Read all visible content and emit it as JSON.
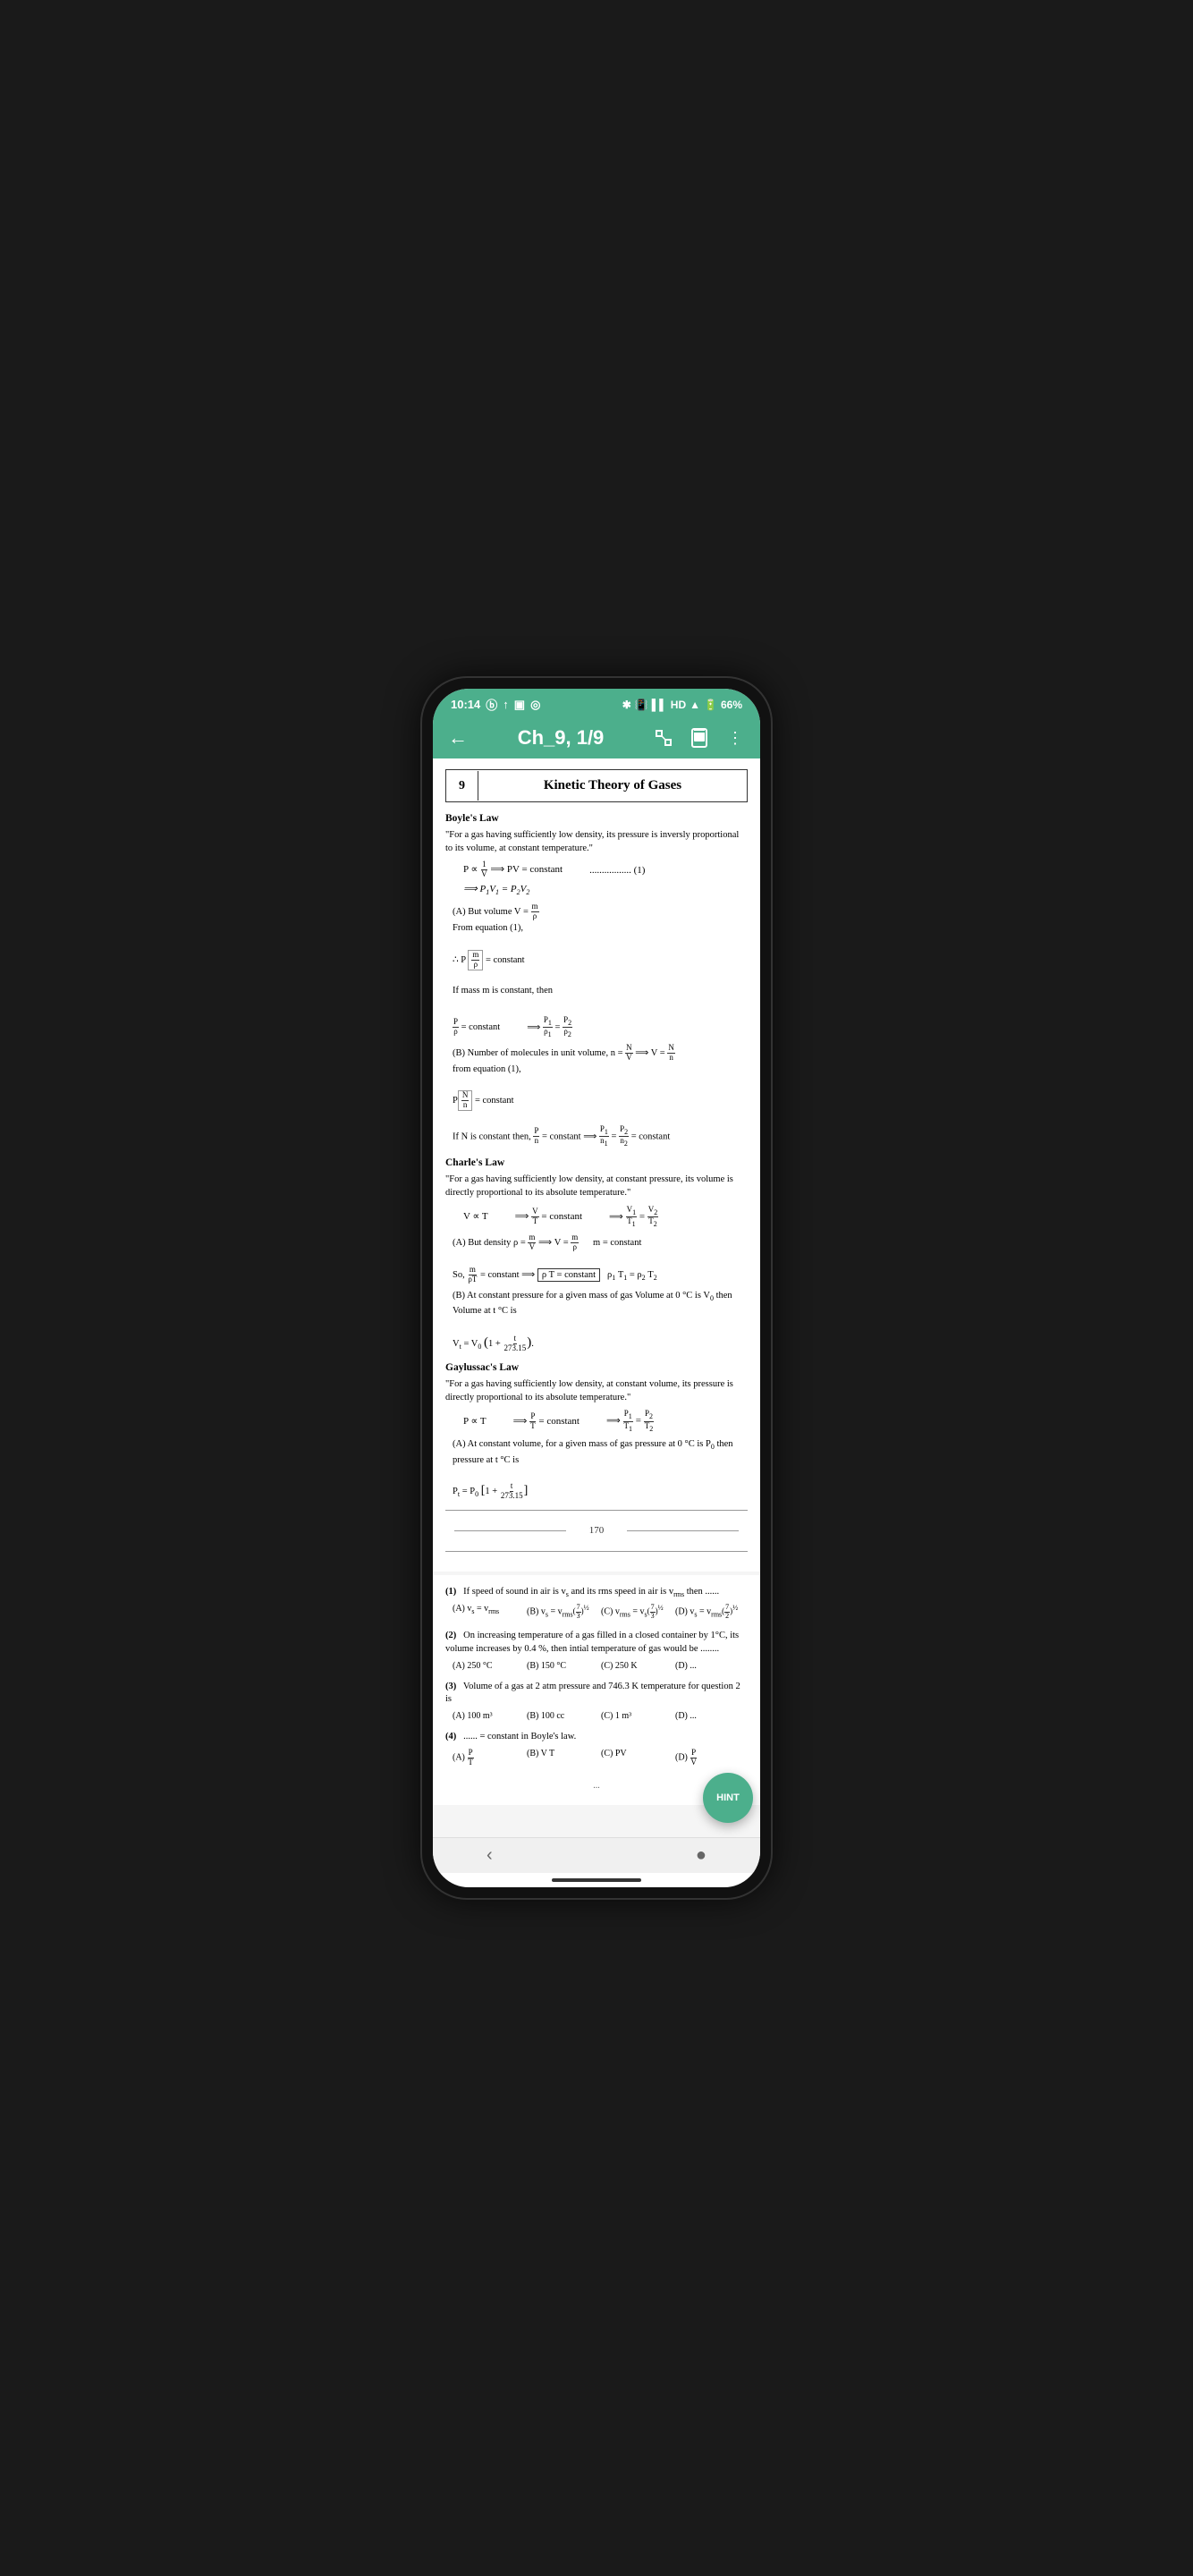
{
  "status_bar": {
    "time": "10:14",
    "icons": [
      "B",
      "↑",
      "☐",
      "@"
    ],
    "right_icons": [
      "bluetooth",
      "vibrate",
      "signal",
      "HD",
      "wifi",
      "battery"
    ],
    "battery": "66%"
  },
  "nav_bar": {
    "back_label": "←",
    "title": "Ch_9, 1/9",
    "icon_expand": "expand",
    "icon_bookmark": "bookmark",
    "icon_more": "more"
  },
  "chapter": {
    "number": "9",
    "title": "Kinetic Theory of Gases"
  },
  "sections": {
    "boyles_law": {
      "heading": "Boyle's Law",
      "quote": "\"For a gas having sufficiently low density, its pressure is inversly proportional to its volume, at constant temperature.\"",
      "equations": [
        "P ∝ 1/V  ⟹ PV = constant  ................. (1)",
        "⟹ P₁V₁ = P₂V₂",
        "(A) But volume V = m/ρ",
        "From equation (1),",
        "∴ P(m/ρ) = constant",
        "If mass m is constant, then",
        "P/ρ = constant  ⟹  P₁/ρ₁ = P₂/ρ₂",
        "(B) Number of molecules in unit volume, n = N/V ⟹ V = N/n",
        "from equation (1),",
        "P(N/n) = constant",
        "If N is constant then, P/n = constant ⟹ P₁/n₁ = P₂/n₂ = constant"
      ]
    },
    "charles_law": {
      "heading": "Charle's Law",
      "quote": "\"For a gas having sufficiently low density, at constant pressure, its volume is directly proportional to its absolute temperature.\"",
      "equations": [
        "V ∝ T  ⟹  V/T = constant  ⟹  V₁/T₁ = V₂/T₂",
        "(A) But density ρ = m/V ⟹ V = m/ρ  m = constant",
        "So, m/ρT = constant ⟹ ρT = constant  ρ₁T₁ = ρ₂T₂",
        "(B) At constant pressure for a given mass of gas Volume at 0 °C is V₀ then Volume at t °C is",
        "Vₜ = V₀(1 + t/273.15)"
      ]
    },
    "gaylussacs_law": {
      "heading": "Gaylussac's Law",
      "quote": "\"For a gas having sufficiently low density, at constant volume, its pressure is directly proportional to its absolute temperature.\"",
      "equations": [
        "P ∝ T  ⟹  P/T = constant  ⟹  P₁/T₁ = P₂/T₂",
        "(A) At constant volume, for a given mass of gas pressure at 0 °C is P₀ then pressure at t °C is",
        "Pₜ = P₀[1 + t/273.15]"
      ]
    }
  },
  "page_number": "170",
  "questions": [
    {
      "number": "(1)",
      "text": "If speed of sound in air is vₛ and its rms speed in air is vᵣₘₛ then ......",
      "options": [
        "(A) vₛ = vᵣₘₛ",
        "(B) vₛ = vᵣₘₛ(7/3)^(1/2)",
        "(C) vᵣₘₛ = vₛ(7/3)^(1/2)",
        "(D) vₛ = vᵣₘₛ(7/2)^(1/2)"
      ]
    },
    {
      "number": "(2)",
      "text": "On increasing temperature of a gas filled in a closed container by 1°C, its volume increases by 0.4 %, then intial temperature of gas would be ........",
      "options": [
        "(A) 250 °C",
        "(B) 150 °C",
        "(C) 250 K",
        "(D) ..."
      ]
    },
    {
      "number": "(3)",
      "text": "Volume of a gas at 2 atm pressure and 746.3 K temperature for question 2 is",
      "options": [
        "(A) 100 m³",
        "(B) 100 cc",
        "(C) 1 m³",
        "(D) ..."
      ]
    },
    {
      "number": "(4)",
      "text": "...... = constant in Boyle's law.",
      "options": [
        "(A) P/T",
        "(B) V T",
        "(C) PV",
        "(D) P/V"
      ]
    }
  ],
  "hint_button": {
    "label": "HINT"
  },
  "bottom_nav": {
    "back": "‹",
    "home": "●"
  }
}
